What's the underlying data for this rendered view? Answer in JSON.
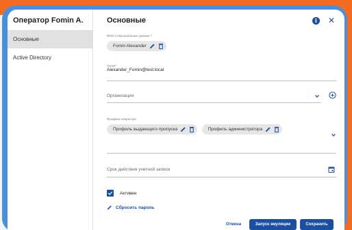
{
  "colors": {
    "accent": "#1b4fa0",
    "frame": "#4a90d9",
    "background_orange": "#f26b21"
  },
  "sidebar": {
    "title": "Оператор Fomin A.",
    "items": [
      {
        "label": "Основные",
        "active": true
      },
      {
        "label": "Active Directory",
        "active": false
      }
    ]
  },
  "header": {
    "title": "Основные",
    "info_icon": "info-icon",
    "close_icon": "close-icon"
  },
  "form": {
    "fio": {
      "label": "ФИО и персональные данные *",
      "chip": "Fomin Alexander"
    },
    "login": {
      "label": "Логин*",
      "value": "Alexander_Fomin@test.local"
    },
    "organization": {
      "placeholder": "Организация"
    },
    "profiles": {
      "label": "Профили оператора",
      "chips": [
        "Профиль выдающего пропуска",
        "Профиль администратора"
      ]
    },
    "expiry": {
      "placeholder": "Срок действия учетной записи"
    },
    "active": {
      "label": "Активен",
      "checked": true
    },
    "reset_password": {
      "label": "Сбросить пароль"
    }
  },
  "footer": {
    "cancel": "Отмена",
    "emulate": "Запуск эмуляции",
    "save": "Сохранить"
  }
}
